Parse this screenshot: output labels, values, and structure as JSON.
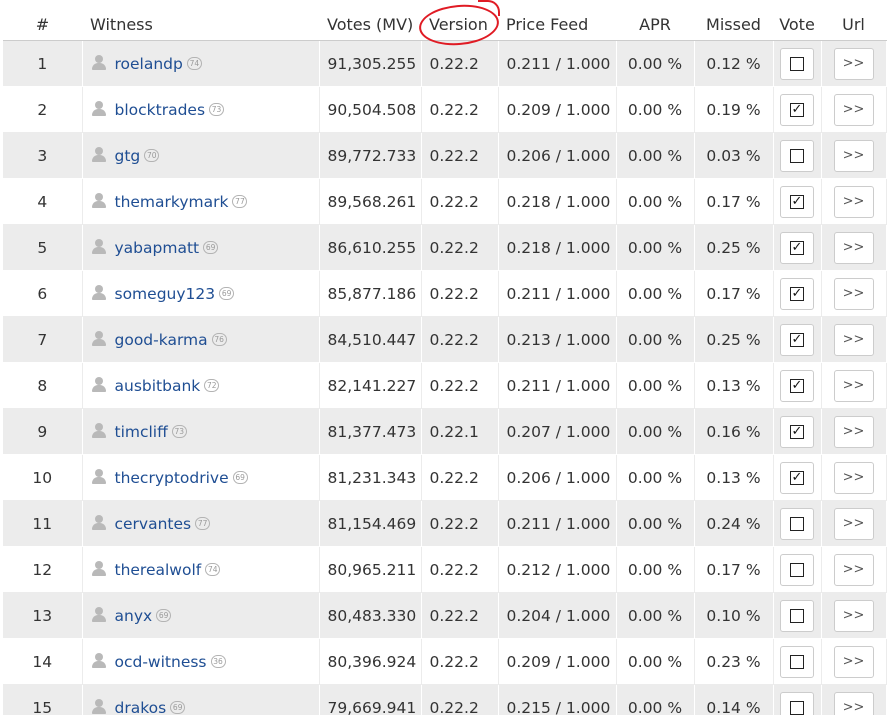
{
  "table": {
    "headers": {
      "rank": "#",
      "witness": "Witness",
      "votes": "Votes (MV)",
      "version": "Version",
      "price_feed": "Price Feed",
      "apr": "APR",
      "missed": "Missed",
      "vote": "Vote",
      "url": "Url"
    },
    "url_button_label": ">>",
    "check_mark": "✓",
    "rows": [
      {
        "rank": "1",
        "name": "roelandp",
        "rep": "74",
        "votes": "91,305.255",
        "version": "0.22.2",
        "price_feed": "0.211 / 1.000",
        "apr": "0.00 %",
        "missed": "0.12 %",
        "voted": false
      },
      {
        "rank": "2",
        "name": "blocktrades",
        "rep": "73",
        "votes": "90,504.508",
        "version": "0.22.2",
        "price_feed": "0.209 / 1.000",
        "apr": "0.00 %",
        "missed": "0.19 %",
        "voted": true
      },
      {
        "rank": "3",
        "name": "gtg",
        "rep": "70",
        "votes": "89,772.733",
        "version": "0.22.2",
        "price_feed": "0.206 / 1.000",
        "apr": "0.00 %",
        "missed": "0.03 %",
        "voted": false
      },
      {
        "rank": "4",
        "name": "themarkymark",
        "rep": "77",
        "votes": "89,568.261",
        "version": "0.22.2",
        "price_feed": "0.218 / 1.000",
        "apr": "0.00 %",
        "missed": "0.17 %",
        "voted": true
      },
      {
        "rank": "5",
        "name": "yabapmatt",
        "rep": "69",
        "votes": "86,610.255",
        "version": "0.22.2",
        "price_feed": "0.218 / 1.000",
        "apr": "0.00 %",
        "missed": "0.25 %",
        "voted": true
      },
      {
        "rank": "6",
        "name": "someguy123",
        "rep": "69",
        "votes": "85,877.186",
        "version": "0.22.2",
        "price_feed": "0.211 / 1.000",
        "apr": "0.00 %",
        "missed": "0.17 %",
        "voted": true
      },
      {
        "rank": "7",
        "name": "good-karma",
        "rep": "76",
        "votes": "84,510.447",
        "version": "0.22.2",
        "price_feed": "0.213 / 1.000",
        "apr": "0.00 %",
        "missed": "0.25 %",
        "voted": true
      },
      {
        "rank": "8",
        "name": "ausbitbank",
        "rep": "72",
        "votes": "82,141.227",
        "version": "0.22.2",
        "price_feed": "0.211 / 1.000",
        "apr": "0.00 %",
        "missed": "0.13 %",
        "voted": true
      },
      {
        "rank": "9",
        "name": "timcliff",
        "rep": "73",
        "votes": "81,377.473",
        "version": "0.22.1",
        "price_feed": "0.207 / 1.000",
        "apr": "0.00 %",
        "missed": "0.16 %",
        "voted": true
      },
      {
        "rank": "10",
        "name": "thecryptodrive",
        "rep": "69",
        "votes": "81,231.343",
        "version": "0.22.2",
        "price_feed": "0.206 / 1.000",
        "apr": "0.00 %",
        "missed": "0.13 %",
        "voted": true
      },
      {
        "rank": "11",
        "name": "cervantes",
        "rep": "77",
        "votes": "81,154.469",
        "version": "0.22.2",
        "price_feed": "0.211 / 1.000",
        "apr": "0.00 %",
        "missed": "0.24 %",
        "voted": false
      },
      {
        "rank": "12",
        "name": "therealwolf",
        "rep": "74",
        "votes": "80,965.211",
        "version": "0.22.2",
        "price_feed": "0.212 / 1.000",
        "apr": "0.00 %",
        "missed": "0.17 %",
        "voted": false
      },
      {
        "rank": "13",
        "name": "anyx",
        "rep": "69",
        "votes": "80,483.330",
        "version": "0.22.2",
        "price_feed": "0.204 / 1.000",
        "apr": "0.00 %",
        "missed": "0.10 %",
        "voted": false
      },
      {
        "rank": "14",
        "name": "ocd-witness",
        "rep": "36",
        "votes": "80,396.924",
        "version": "0.22.2",
        "price_feed": "0.209 / 1.000",
        "apr": "0.00 %",
        "missed": "0.23 %",
        "voted": false
      },
      {
        "rank": "15",
        "name": "drakos",
        "rep": "69",
        "votes": "79,669.941",
        "version": "0.22.2",
        "price_feed": "0.215 / 1.000",
        "apr": "0.00 %",
        "missed": "0.14 %",
        "voted": false
      }
    ]
  },
  "annotation": {
    "color": "#e01b24",
    "target": "version-header"
  }
}
